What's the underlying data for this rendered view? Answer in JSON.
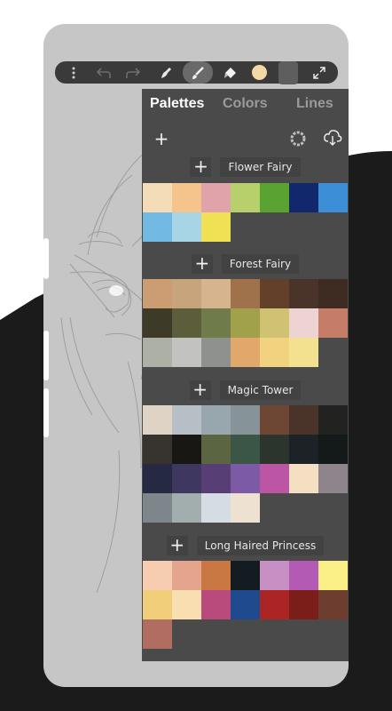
{
  "colors": {
    "background_dark": "#1b1b1b",
    "phone_body": "#c6c6c6",
    "panel_bg": "#4a4a4a",
    "active_tab": "#ffffff",
    "inactive_tab": "#9a9a9a",
    "current_color": "#f4d9a6"
  },
  "toolbar": {
    "icons": [
      "more-vertical-icon",
      "undo-icon",
      "redo-icon",
      "smudge-icon",
      "brush-icon",
      "eraser-icon",
      "current-color-swatch",
      "layers-icon",
      "fullscreen-icon"
    ],
    "active": "brush-icon"
  },
  "tabs": [
    {
      "label": "Palettes",
      "active": true
    },
    {
      "label": "Colors",
      "active": false
    },
    {
      "label": "Lines",
      "active": false
    }
  ],
  "panel_actions": {
    "add_symbol": "+",
    "icons": [
      "add-palette-icon",
      "color-wheel-icon",
      "cloud-download-icon"
    ]
  },
  "palettes": [
    {
      "name": "Flower Fairy",
      "add_symbol": "+",
      "colors": [
        "#f4dcb7",
        "#f4c48c",
        "#e0a3aa",
        "#b8d06b",
        "#5aa333",
        "#11286d",
        "#3c8fd6",
        "#72b9e3",
        "#a8d5e6",
        "#efe153"
      ]
    },
    {
      "name": "Forest Fairy",
      "add_symbol": "+",
      "colors": [
        "#cc9c72",
        "#c8a47c",
        "#d6b58e",
        "#9f724c",
        "#63402a",
        "#4a3328",
        "#3e2c23",
        "#3d3b28",
        "#5b5d3b",
        "#6f7b48",
        "#a1a04b",
        "#cfc272",
        "#eed3d3",
        "#c57d68",
        "#adb0a4",
        "#c2c3c0",
        "#8e918d",
        "#e2a86b",
        "#f0d27f",
        "#f4e18f"
      ]
    },
    {
      "name": "Magic Tower",
      "add_symbol": "+",
      "colors": [
        "#dfd3c6",
        "#b6bfc5",
        "#98a6ae",
        "#869399",
        "#6d4734",
        "#4a3328",
        "#222220",
        "#37332f",
        "#191714",
        "#5b6541",
        "#3b5646",
        "#2b352d",
        "#1d2226",
        "#141a19",
        "#252a42",
        "#3e3760",
        "#573e75",
        "#7d5aa6",
        "#bd55a5",
        "#f5dfc2",
        "#8e848b",
        "#7d878b",
        "#a2adae",
        "#d5dce4",
        "#eee1d2"
      ]
    },
    {
      "name": "Long Haired Princess",
      "add_symbol": "+",
      "colors": [
        "#f6cdb0",
        "#e5a58c",
        "#c97843",
        "#131c21",
        "#c88fc5",
        "#b25ab4",
        "#fbef88",
        "#f1ce79",
        "#f8deb0",
        "#b84b7c",
        "#1f4a8e",
        "#aa2523",
        "#7b1d18",
        "#6d3e2f",
        "#b16e60"
      ]
    }
  ]
}
